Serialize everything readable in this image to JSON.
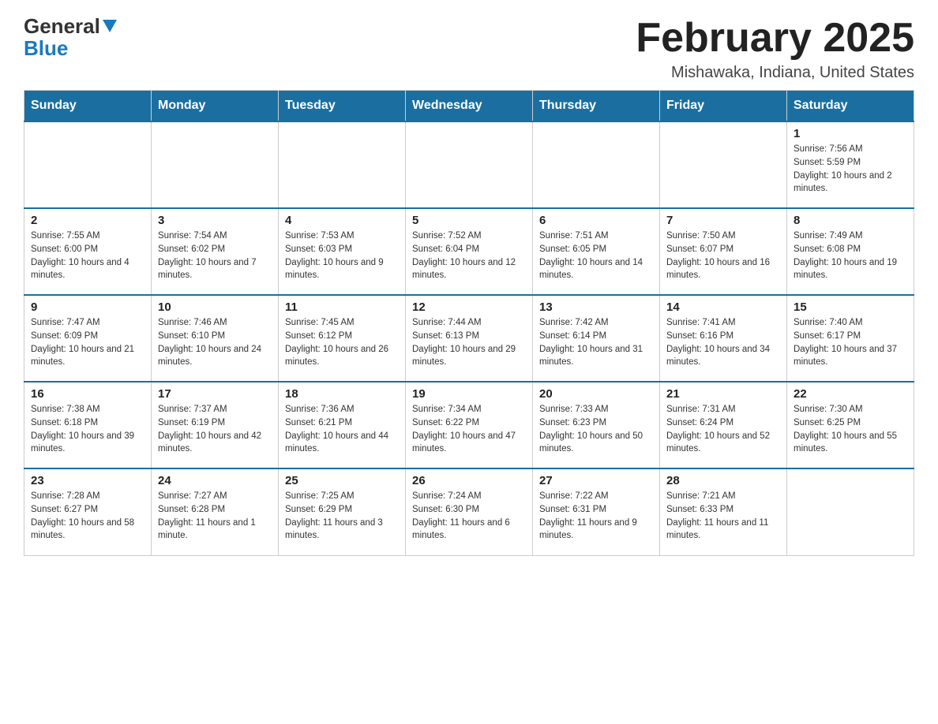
{
  "header": {
    "logo_general": "General",
    "logo_blue": "Blue",
    "month_title": "February 2025",
    "location": "Mishawaka, Indiana, United States"
  },
  "days_of_week": [
    "Sunday",
    "Monday",
    "Tuesday",
    "Wednesday",
    "Thursday",
    "Friday",
    "Saturday"
  ],
  "weeks": [
    {
      "days": [
        {
          "date": "",
          "info": ""
        },
        {
          "date": "",
          "info": ""
        },
        {
          "date": "",
          "info": ""
        },
        {
          "date": "",
          "info": ""
        },
        {
          "date": "",
          "info": ""
        },
        {
          "date": "",
          "info": ""
        },
        {
          "date": "1",
          "info": "Sunrise: 7:56 AM\nSunset: 5:59 PM\nDaylight: 10 hours and 2 minutes."
        }
      ]
    },
    {
      "days": [
        {
          "date": "2",
          "info": "Sunrise: 7:55 AM\nSunset: 6:00 PM\nDaylight: 10 hours and 4 minutes."
        },
        {
          "date": "3",
          "info": "Sunrise: 7:54 AM\nSunset: 6:02 PM\nDaylight: 10 hours and 7 minutes."
        },
        {
          "date": "4",
          "info": "Sunrise: 7:53 AM\nSunset: 6:03 PM\nDaylight: 10 hours and 9 minutes."
        },
        {
          "date": "5",
          "info": "Sunrise: 7:52 AM\nSunset: 6:04 PM\nDaylight: 10 hours and 12 minutes."
        },
        {
          "date": "6",
          "info": "Sunrise: 7:51 AM\nSunset: 6:05 PM\nDaylight: 10 hours and 14 minutes."
        },
        {
          "date": "7",
          "info": "Sunrise: 7:50 AM\nSunset: 6:07 PM\nDaylight: 10 hours and 16 minutes."
        },
        {
          "date": "8",
          "info": "Sunrise: 7:49 AM\nSunset: 6:08 PM\nDaylight: 10 hours and 19 minutes."
        }
      ]
    },
    {
      "days": [
        {
          "date": "9",
          "info": "Sunrise: 7:47 AM\nSunset: 6:09 PM\nDaylight: 10 hours and 21 minutes."
        },
        {
          "date": "10",
          "info": "Sunrise: 7:46 AM\nSunset: 6:10 PM\nDaylight: 10 hours and 24 minutes."
        },
        {
          "date": "11",
          "info": "Sunrise: 7:45 AM\nSunset: 6:12 PM\nDaylight: 10 hours and 26 minutes."
        },
        {
          "date": "12",
          "info": "Sunrise: 7:44 AM\nSunset: 6:13 PM\nDaylight: 10 hours and 29 minutes."
        },
        {
          "date": "13",
          "info": "Sunrise: 7:42 AM\nSunset: 6:14 PM\nDaylight: 10 hours and 31 minutes."
        },
        {
          "date": "14",
          "info": "Sunrise: 7:41 AM\nSunset: 6:16 PM\nDaylight: 10 hours and 34 minutes."
        },
        {
          "date": "15",
          "info": "Sunrise: 7:40 AM\nSunset: 6:17 PM\nDaylight: 10 hours and 37 minutes."
        }
      ]
    },
    {
      "days": [
        {
          "date": "16",
          "info": "Sunrise: 7:38 AM\nSunset: 6:18 PM\nDaylight: 10 hours and 39 minutes."
        },
        {
          "date": "17",
          "info": "Sunrise: 7:37 AM\nSunset: 6:19 PM\nDaylight: 10 hours and 42 minutes."
        },
        {
          "date": "18",
          "info": "Sunrise: 7:36 AM\nSunset: 6:21 PM\nDaylight: 10 hours and 44 minutes."
        },
        {
          "date": "19",
          "info": "Sunrise: 7:34 AM\nSunset: 6:22 PM\nDaylight: 10 hours and 47 minutes."
        },
        {
          "date": "20",
          "info": "Sunrise: 7:33 AM\nSunset: 6:23 PM\nDaylight: 10 hours and 50 minutes."
        },
        {
          "date": "21",
          "info": "Sunrise: 7:31 AM\nSunset: 6:24 PM\nDaylight: 10 hours and 52 minutes."
        },
        {
          "date": "22",
          "info": "Sunrise: 7:30 AM\nSunset: 6:25 PM\nDaylight: 10 hours and 55 minutes."
        }
      ]
    },
    {
      "days": [
        {
          "date": "23",
          "info": "Sunrise: 7:28 AM\nSunset: 6:27 PM\nDaylight: 10 hours and 58 minutes."
        },
        {
          "date": "24",
          "info": "Sunrise: 7:27 AM\nSunset: 6:28 PM\nDaylight: 11 hours and 1 minute."
        },
        {
          "date": "25",
          "info": "Sunrise: 7:25 AM\nSunset: 6:29 PM\nDaylight: 11 hours and 3 minutes."
        },
        {
          "date": "26",
          "info": "Sunrise: 7:24 AM\nSunset: 6:30 PM\nDaylight: 11 hours and 6 minutes."
        },
        {
          "date": "27",
          "info": "Sunrise: 7:22 AM\nSunset: 6:31 PM\nDaylight: 11 hours and 9 minutes."
        },
        {
          "date": "28",
          "info": "Sunrise: 7:21 AM\nSunset: 6:33 PM\nDaylight: 11 hours and 11 minutes."
        },
        {
          "date": "",
          "info": ""
        }
      ]
    }
  ]
}
